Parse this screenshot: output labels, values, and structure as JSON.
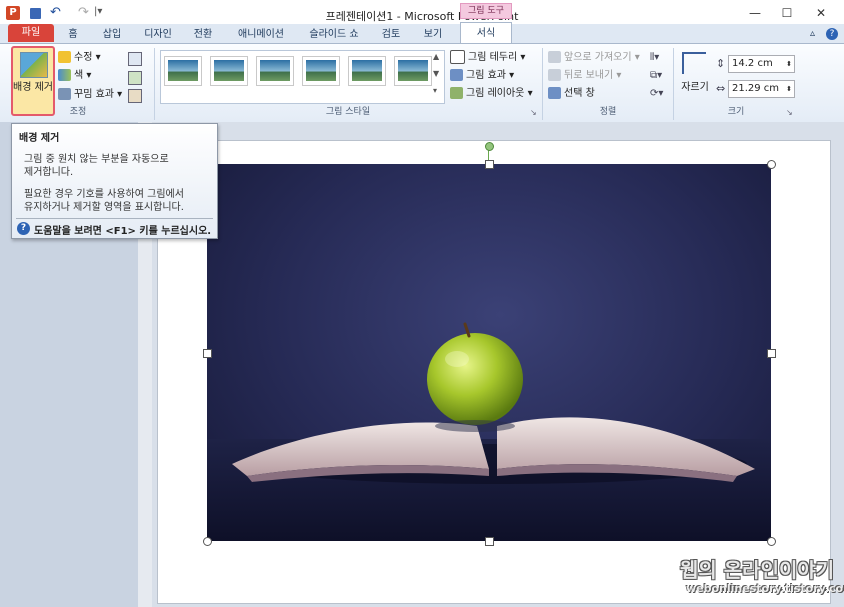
{
  "window": {
    "title": "프레젠테이션1 - Microsoft PowerPoint",
    "contextual_group": "그림 도구",
    "controls": [
      "—",
      "☐",
      "✕"
    ]
  },
  "tabs": [
    {
      "label": "파일"
    },
    {
      "label": "홈"
    },
    {
      "label": "삽입"
    },
    {
      "label": "디자인"
    },
    {
      "label": "전환"
    },
    {
      "label": "애니메이션"
    },
    {
      "label": "슬라이드 쇼"
    },
    {
      "label": "검토"
    },
    {
      "label": "보기"
    },
    {
      "label": "서식"
    }
  ],
  "ribbon": {
    "adjust": {
      "background_remove_label": "배경 제거",
      "corrections": "수정",
      "color": "색",
      "artistic_effects": "꾸밈 효과",
      "group_label": "조정"
    },
    "picture_styles": {
      "border": "그림 테두리",
      "effects": "그림 효과",
      "layout": "그림 레이아웃",
      "group_label": "그림 스타일"
    },
    "arrange": {
      "bring_forward": "앞으로 가져오기",
      "send_backward": "뒤로 보내기",
      "selection_pane": "선택 창",
      "group_label": "정렬"
    },
    "size": {
      "crop": "자르기",
      "height": "14.2 cm",
      "width": "21.29 cm",
      "group_label": "크기"
    }
  },
  "tooltip": {
    "title": "배경 제거",
    "line1": "그림 중 원치 않는 부분을 자동으로",
    "line2": "제거합니다.",
    "line3": "필요한 경우 기호를 사용하여 그림에서",
    "line4": "유지하거나 제거할 영역을 표시합니다.",
    "help": "도움말을 보려면 <F1> 키를 누르십시오."
  },
  "watermark": {
    "line1": "웹의 온라인이야기",
    "line2": "webonlinestory.tistory.com"
  },
  "colors": {
    "file_tab": "#d9443a",
    "highlight": "#e45a6b",
    "contextual": "#f4c9df"
  }
}
